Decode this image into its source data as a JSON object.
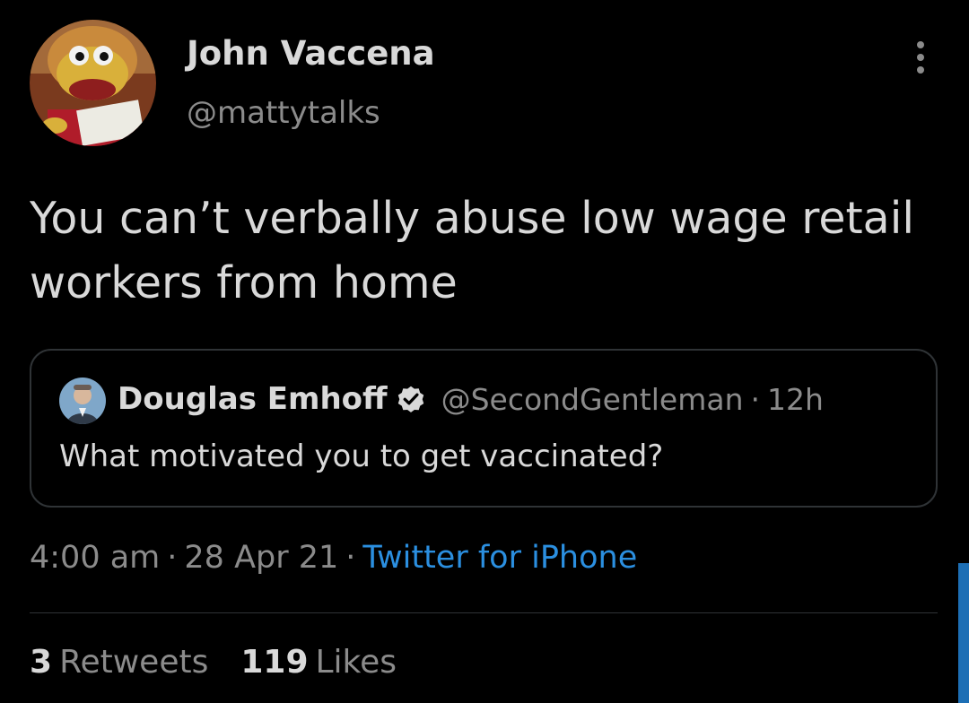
{
  "tweet": {
    "author": {
      "name": "John Vaccena",
      "handle": "@mattytalks",
      "avatar_icon": "puppet-avatar"
    },
    "more_icon": "more-vertical-icon",
    "text": "You can’t verbally abuse low wage retail workers from home",
    "quoted": {
      "name": "Douglas Emhoff",
      "verified_icon": "verified-badge-icon",
      "handle": "@SecondGentleman",
      "separator": "·",
      "time": "12h",
      "text": "What motivated you to get vaccinated?"
    },
    "meta": {
      "time": "4:00 am",
      "separator": "·",
      "date": "28 Apr 21",
      "source": "Twitter for iPhone"
    },
    "stats": {
      "retweets_count": "3",
      "retweets_label": "Retweets",
      "likes_count": "119",
      "likes_label": "Likes"
    }
  },
  "colors": {
    "background": "#000000",
    "text_primary": "#d9d9d9",
    "text_secondary": "#8b8b8b",
    "link": "#2b8fe0",
    "border": "#2f3336",
    "scroll_indicator": "#1d6fb5"
  }
}
